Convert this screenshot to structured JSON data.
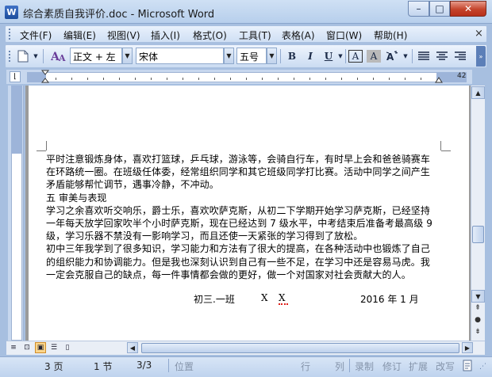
{
  "window": {
    "title": "综合素质自我评价.doc - Microsoft Word",
    "app_icon_letter": "W",
    "min_glyph": "–",
    "max_glyph": "□",
    "close_glyph": "✕"
  },
  "menubar": {
    "items": [
      "文件(F)",
      "编辑(E)",
      "视图(V)",
      "插入(I)",
      "格式(O)",
      "工具(T)",
      "表格(A)",
      "窗口(W)",
      "帮助(H)"
    ],
    "doc_close": "×"
  },
  "toolbar": {
    "style_value": "正文 + 左",
    "font_value": "宋体",
    "size_value": "五号",
    "bold": "B",
    "italic": "I",
    "underline": "U",
    "char_border": "A",
    "char_shading": "A"
  },
  "ruler": {
    "right_number": "42"
  },
  "document": {
    "lines": [
      "平时注意锻炼身体，喜欢打篮球，乒乓球，游泳等，会骑自行车，有时早上会和爸爸骑赛车",
      "在环路统一圈。在班级任体委，经常组织同学和其它班级同学打比赛。活动中同学之间产生",
      "矛盾能够帮忙调节，遇事冷静，不冲动。",
      "五  审美与表现",
      "学习之余喜欢听交响乐，爵士乐，喜欢吹萨克斯，从初二下学期开始学习萨克斯，已经坚持",
      "一年每天放学回家吹半个小时萨克斯，现在已经达到 7 级水平，中考结束后准备考最高级 9",
      "级，学习乐器不禁没有一影响学习，而且还使一天紧张的学习得到了放松。",
      "初中三年我学到了很多知识，学习能力和方法有了很大的提高，在各种活动中也锻炼了自己",
      "的组织能力和协调能力。但是我也深刻认识到自己有一些不足，在学习中还是容易马虎。我",
      "一定会克服自己的缺点，每一件事情都会做的更好，做一个对国家对社会贡献大的人。"
    ],
    "signature": {
      "class": "初三.一班",
      "name1": "X",
      "name2": "X",
      "date": "2016 年 1 月"
    }
  },
  "statusbar": {
    "page": "3 页",
    "section": "1 节",
    "pages": "3/3",
    "position": "位置",
    "line": "行",
    "column": "列",
    "rec": "录制",
    "trk": "修订",
    "ext": "扩展",
    "ovr": "改写"
  }
}
